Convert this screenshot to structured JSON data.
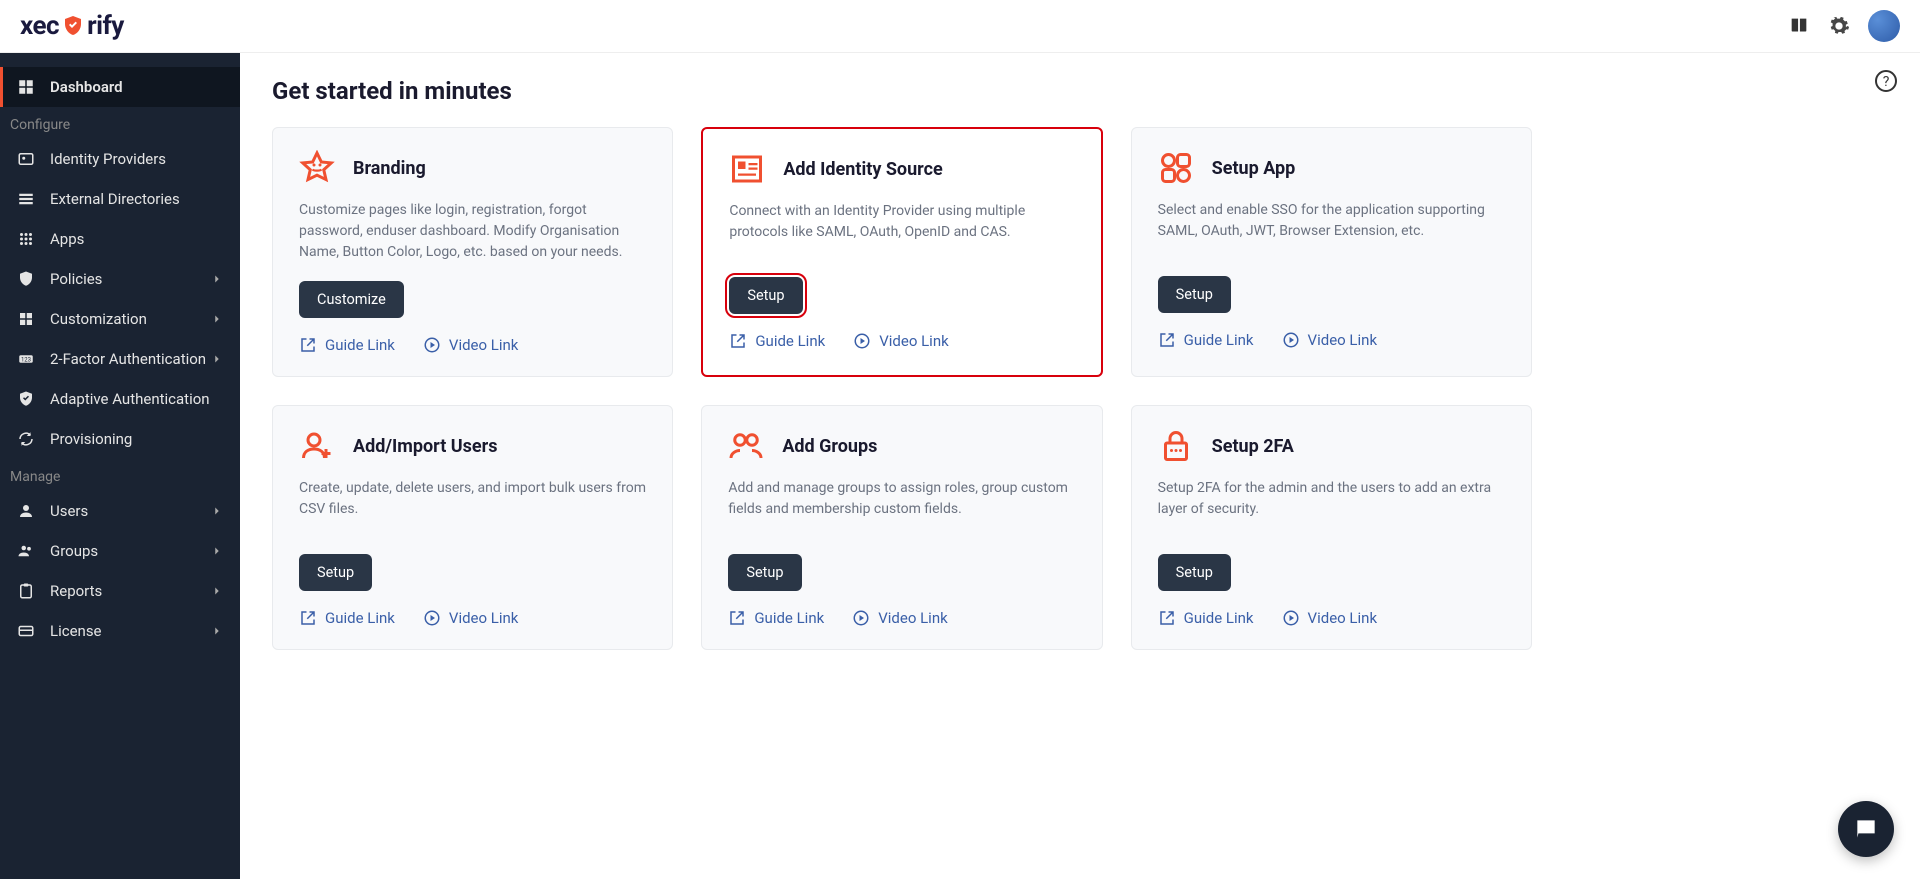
{
  "logo_text_a": "xec",
  "logo_text_b": "rify",
  "sidebar": {
    "section_configure": "Configure",
    "section_manage": "Manage",
    "items": [
      {
        "label": "Dashboard"
      },
      {
        "label": "Identity Providers"
      },
      {
        "label": "External Directories"
      },
      {
        "label": "Apps"
      },
      {
        "label": "Policies"
      },
      {
        "label": "Customization"
      },
      {
        "label": "2-Factor Authentication"
      },
      {
        "label": "Adaptive Authentication"
      },
      {
        "label": "Provisioning"
      },
      {
        "label": "Users"
      },
      {
        "label": "Groups"
      },
      {
        "label": "Reports"
      },
      {
        "label": "License"
      }
    ]
  },
  "page_title": "Get started in minutes",
  "links": {
    "guide": "Guide Link",
    "video": "Video Link"
  },
  "cards": [
    {
      "title": "Branding",
      "desc": "Customize pages like login, registration, forgot password, enduser dashboard. Modify Organisation Name, Button Color, Logo, etc. based on your needs.",
      "btn": "Customize"
    },
    {
      "title": "Add Identity Source",
      "desc": "Connect with an Identity Provider using multiple protocols like SAML, OAuth, OpenID and CAS.",
      "btn": "Setup"
    },
    {
      "title": "Setup App",
      "desc": "Select and enable SSO for the application supporting SAML, OAuth, JWT, Browser Extension, etc.",
      "btn": "Setup"
    },
    {
      "title": "Add/Import Users",
      "desc": "Create, update, delete users, and import bulk users from CSV files.",
      "btn": "Setup"
    },
    {
      "title": "Add Groups",
      "desc": "Add and manage groups to assign roles, group custom fields and membership custom fields.",
      "btn": "Setup"
    },
    {
      "title": "Setup 2FA",
      "desc": "Setup 2FA for the admin and the users to add an extra layer of security.",
      "btn": "Setup"
    }
  ]
}
